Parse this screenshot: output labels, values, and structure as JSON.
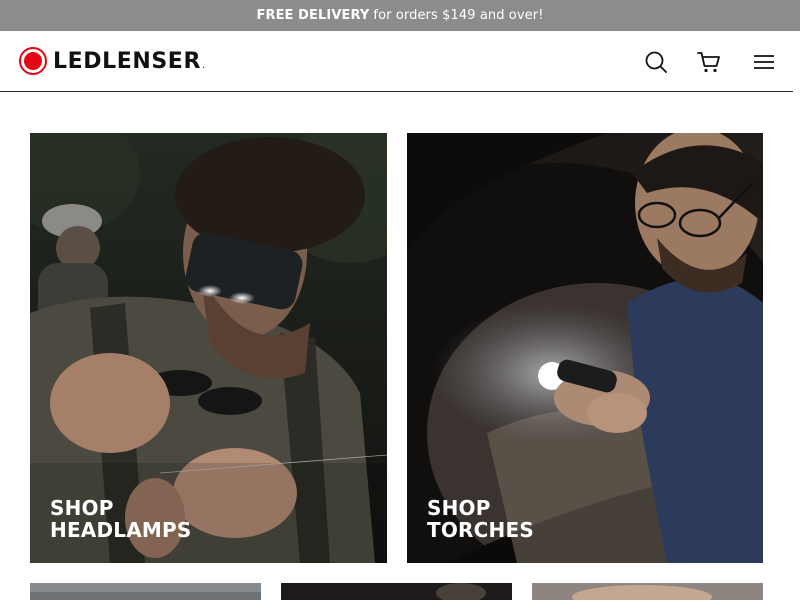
{
  "announcement": {
    "bold": "FREE DELIVERY",
    "rest": "for orders $149 and over!"
  },
  "header": {
    "logo_text": "LEDLENSER",
    "logo_suffix": "."
  },
  "tiles": [
    {
      "line1": "SHOP",
      "line2": "HEADLAMPS"
    },
    {
      "line1": "SHOP",
      "line2": "TORCHES"
    }
  ],
  "colors": {
    "announcement_bg": "#8c8c8c",
    "brand_red": "#e30613"
  },
  "icons": [
    "search-icon",
    "cart-icon",
    "menu-icon"
  ]
}
